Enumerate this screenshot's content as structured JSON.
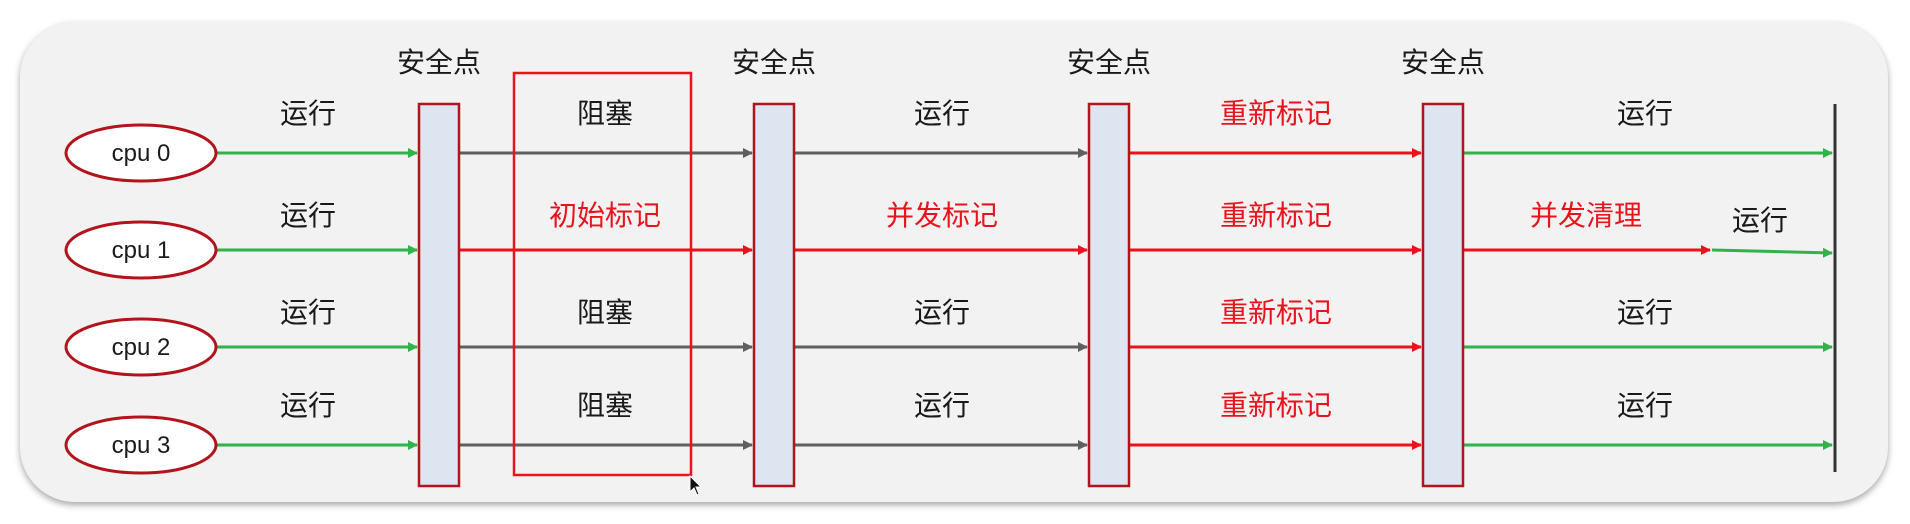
{
  "colors": {
    "run": "#2fb34a",
    "gray": "#5f5f5f",
    "red": "#e8141b",
    "ellipse_stroke": "#b3141b",
    "safepoint_fill": "#dde5f1",
    "safepoint_stroke": "#b3141b",
    "text": "#1a1a1a"
  },
  "cpus": [
    "cpu 0",
    "cpu 1",
    "cpu 2",
    "cpu 3"
  ],
  "safepoint_label": "安全点",
  "phases": [
    {
      "labels": [
        "运行",
        "运行",
        "运行",
        "运行"
      ],
      "colors": [
        "black",
        "black",
        "black",
        "black"
      ],
      "lines": [
        "green",
        "green",
        "green",
        "green"
      ]
    },
    {
      "labels": [
        "阻塞",
        "初始标记",
        "阻塞",
        "阻塞"
      ],
      "colors": [
        "black",
        "red",
        "black",
        "black"
      ],
      "lines": [
        "gray",
        "red",
        "gray",
        "gray"
      ]
    },
    {
      "labels": [
        "运行",
        "并发标记",
        "运行",
        "运行"
      ],
      "colors": [
        "black",
        "red",
        "black",
        "black"
      ],
      "lines": [
        "gray",
        "red",
        "gray",
        "gray"
      ]
    },
    {
      "labels": [
        "重新标记",
        "重新标记",
        "重新标记",
        "重新标记"
      ],
      "colors": [
        "red",
        "red",
        "red",
        "red"
      ],
      "lines": [
        "red",
        "red",
        "red",
        "red"
      ]
    },
    {
      "labels": [
        "运行",
        "并发清理",
        "运行",
        "运行"
      ],
      "colors": [
        "black",
        "red",
        "black",
        "black"
      ],
      "lines": [
        "green",
        "red",
        "green",
        "green"
      ]
    }
  ],
  "extra_run_label": "运行"
}
